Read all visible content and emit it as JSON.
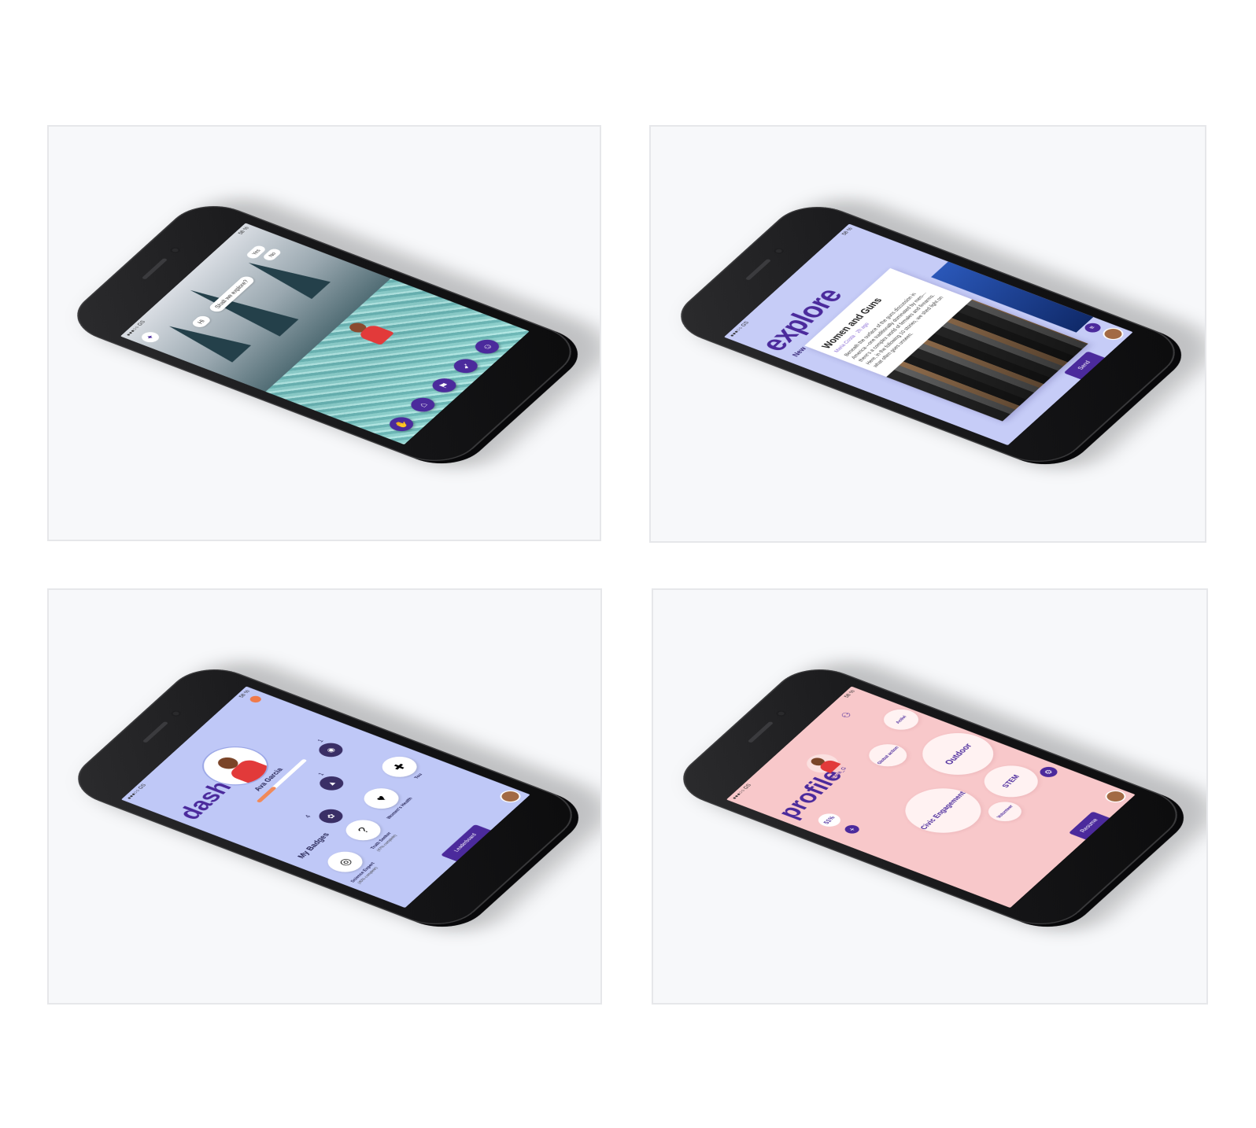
{
  "status_bar": {
    "carrier": "●●●○○ GS",
    "battery": "58 %"
  },
  "screen1": {
    "bubble_hi": "Hi",
    "bubble_question": "Shall we explore?",
    "yes_label": "Yes",
    "no_label": "No",
    "icons": [
      "sparkle-icon",
      "building-icon",
      "flag-icon",
      "compass-icon",
      "smile-icon"
    ]
  },
  "screen2": {
    "title": "explore",
    "tab": "New",
    "card_title": "Women and Guns",
    "card_meta": "Maria Costa · 2h ago",
    "card_text": "Beneath the surface of the guns discussion in America—one traditionally dominated by men—there's a complex world of females and firearms. Here, in the following 10 stories, we shed light on what often goes unseen.",
    "send_label": "Send"
  },
  "screen3": {
    "title": "dash",
    "user_name": "Ava Garcia",
    "progress": 0.35,
    "stats": [
      "1",
      "1",
      "4"
    ],
    "badges_title": "My Badges",
    "badges": [
      {
        "label": "Science Expert",
        "sub": "(40% complete)",
        "icon": "science-badge"
      },
      {
        "label": "Truth Seeker",
        "sub": "(47% complete)",
        "icon": "question-badge"
      },
      {
        "label": "Women's Health",
        "sub": "",
        "icon": "heart-badge"
      },
      {
        "label": "Tou",
        "sub": "",
        "icon": "partial-badge"
      }
    ],
    "leaderboard_label": "Leaderboard"
  },
  "screen4": {
    "title": "profile",
    "handle": "@Ava_G",
    "percent": "51%",
    "resume_label": "Resume",
    "categories": [
      "Global action",
      "Activi",
      "Outdoor",
      "Civic Engagement",
      "Volunteer",
      "STEM"
    ]
  }
}
